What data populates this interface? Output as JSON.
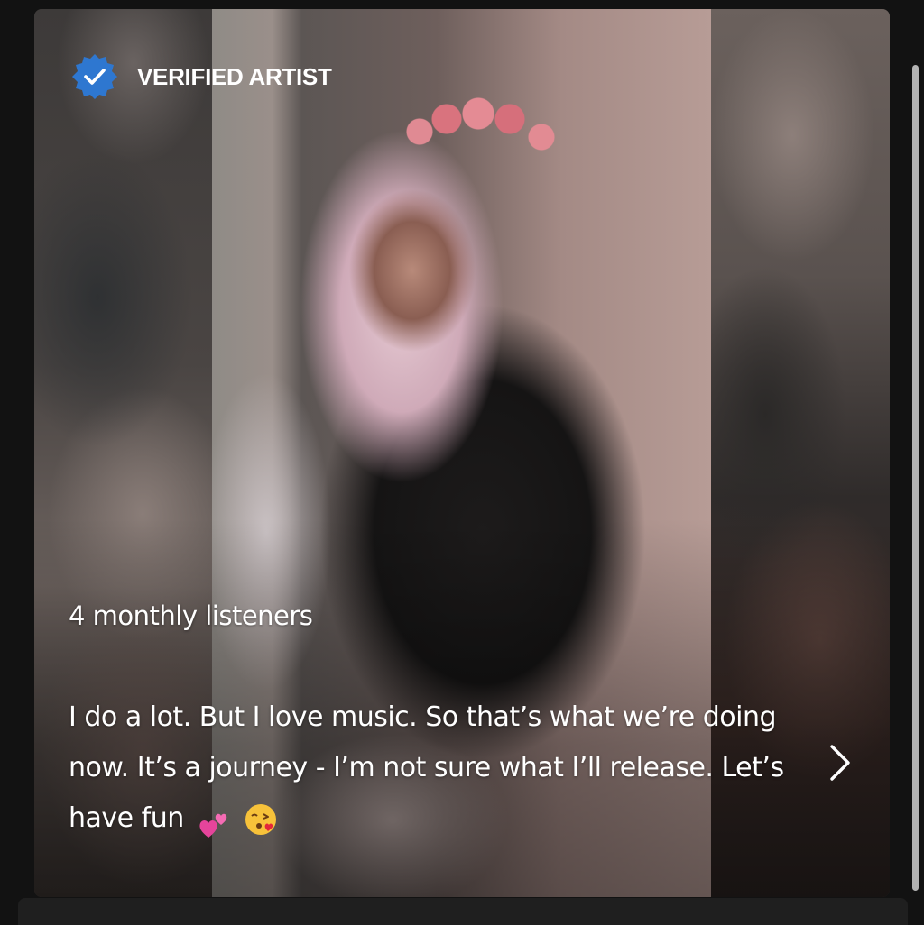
{
  "artist_about": {
    "verified_label": "VERIFIED ARTIST",
    "monthly_listeners": "4 monthly listeners",
    "bio": "I do a lot. But I love music. So that’s what we’re doing now. It’s a journey - I’m not sure what I’ll release. Let’s have fun",
    "bio_emojis": [
      "two-hearts",
      "face-blowing-a-kiss"
    ],
    "icons": {
      "verified": "verified-badge-icon",
      "open": "chevron-right-icon"
    }
  },
  "colors": {
    "background": "#121212",
    "verified_badge": "#2e77d0",
    "text": "#ffffff"
  }
}
